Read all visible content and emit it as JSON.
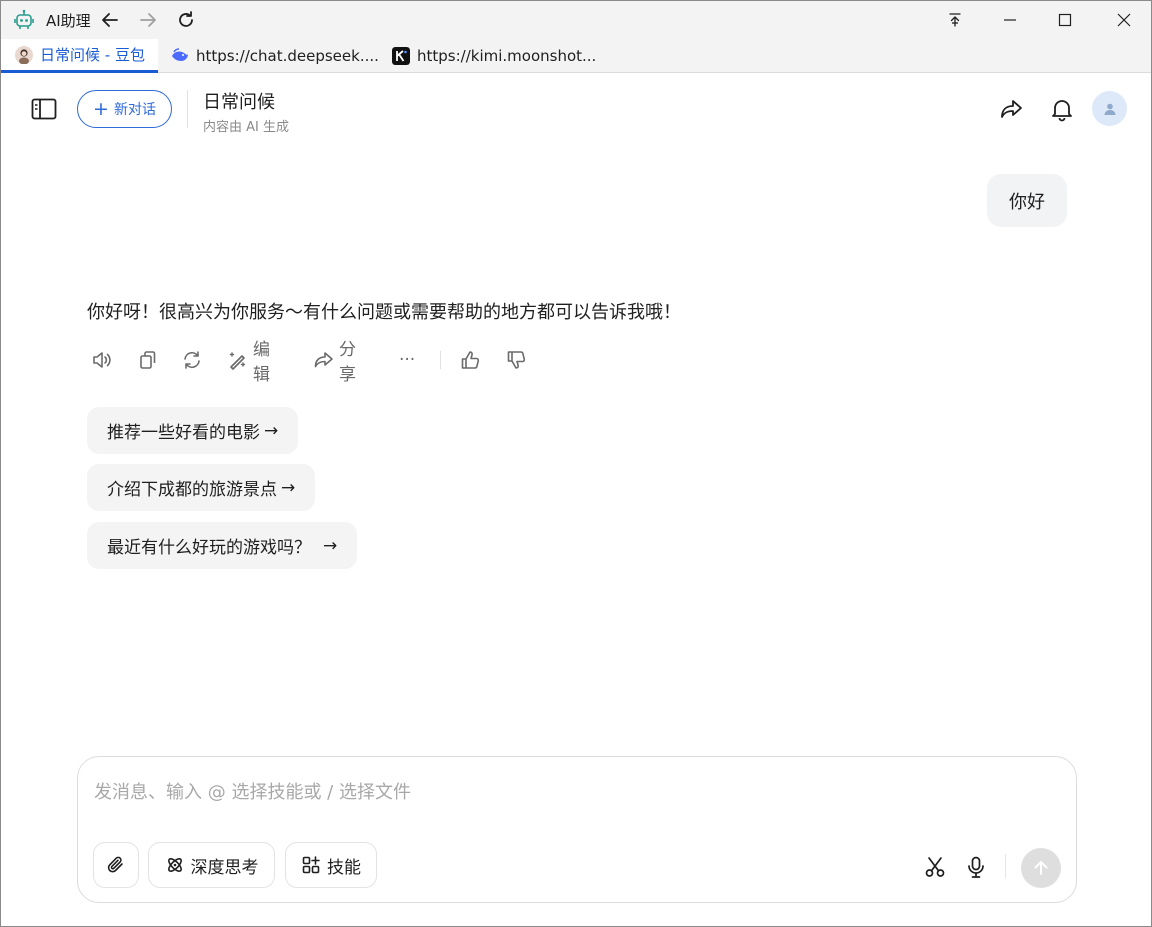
{
  "window": {
    "app_title": "AI助理",
    "icons": [
      "robot-icon",
      "back-arrow-icon",
      "forward-arrow-icon",
      "reload-icon",
      "pin-icon",
      "minimize-icon",
      "maximize-icon",
      "close-icon"
    ]
  },
  "tabs": [
    {
      "label": "日常问候 - 豆包",
      "active": true,
      "icon": "doubao-avatar-icon"
    },
    {
      "label": "https://chat.deepseek....",
      "active": false,
      "icon": "deepseek-whale-icon"
    },
    {
      "label": "https://kimi.moonshot...",
      "active": false,
      "icon": "kimi-logo-icon"
    }
  ],
  "header": {
    "new_chat_label": "新对话",
    "title": "日常问候",
    "subtitle": "内容由 AI 生成"
  },
  "conversation": {
    "user_message": "你好",
    "bot_message": "你好呀！很高兴为你服务～有什么问题或需要帮助的地方都可以告诉我哦！",
    "actions": {
      "edit_label": "编辑",
      "share_label": "分享",
      "more_label": "···"
    },
    "suggestions": [
      {
        "label": "推荐一些好看的电影",
        "arrow": "→"
      },
      {
        "label": "介绍下成都的旅游景点",
        "arrow": "→"
      },
      {
        "label": "最近有什么好玩的游戏吗？",
        "arrow": "→"
      }
    ]
  },
  "composer": {
    "placeholder": "发消息、输入 @ 选择技能或 / 选择文件",
    "deep_think_label": "深度思考",
    "skills_label": "技能"
  },
  "colors": {
    "accent": "#2f6ad9",
    "tab_active": "#1a5cd6",
    "bubble_bg": "#f2f3f5",
    "send_disabled": "#dedede"
  }
}
